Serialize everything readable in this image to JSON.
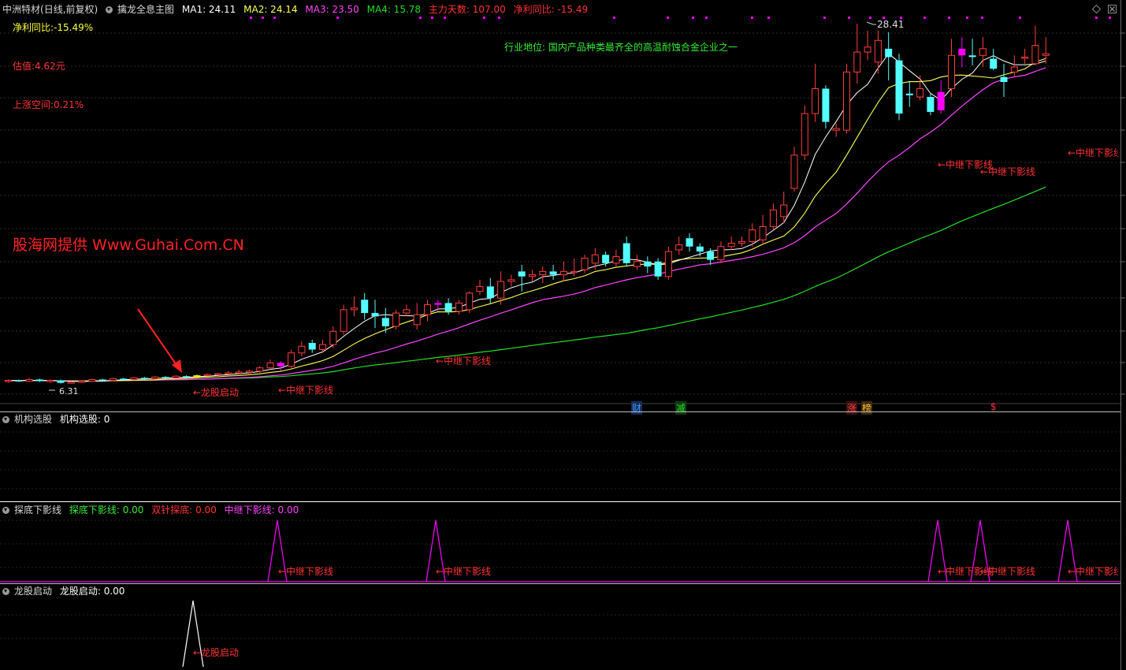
{
  "header": {
    "stock": "中洲特材",
    "mode": "(日线,前复权)",
    "indicator": "擒龙全息主图",
    "ma1": "MA1: 24.11",
    "ma2": "MA2: 24.14",
    "ma3": "MA3: 23.50",
    "ma4": "MA4: 15.78",
    "days": "主力天数: 107.00",
    "profit": "净利同比: -15.49"
  },
  "info": {
    "profit_yoy": "净利同比:-15.49%",
    "valuation": "估值:4.62元",
    "upside": "上涨空间:0.21%",
    "industry": "行业地位: 国内产品种类最齐全的高温耐蚀合金企业之一",
    "watermark": "股海网提供 Www.Guhai.Com.CN",
    "max_price": "28.41",
    "min_price": "6.31"
  },
  "event_icons": [
    "财",
    "减",
    "涨",
    "榜",
    "$"
  ],
  "panel2": {
    "name": "机构选股",
    "value": "机构选股: 0"
  },
  "panel3": {
    "name": "探底下影线",
    "v1": "探底下影线: 0.00",
    "v2": "双针探底: 0.00",
    "v3": "中继下影线: 0.00"
  },
  "panel4": {
    "name": "龙股启动",
    "value": "龙股启动: 0.00"
  },
  "annotations": {
    "relay": "←中继下影线",
    "dragon": "←龙股启动"
  },
  "colors": {
    "up": "#ff3c3c",
    "down": "#54ffff",
    "ma1": "#ffffff",
    "ma2": "#ffff55",
    "ma3": "#ff44ff",
    "ma4": "#22dd22",
    "signal": "#ff00ff"
  },
  "chart_data": {
    "type": "candlestick",
    "price_range": [
      6.31,
      28.41
    ],
    "candles": [
      {
        "o": 6.9,
        "c": 6.95,
        "h": 7.0,
        "l": 6.8
      },
      {
        "o": 6.95,
        "c": 6.9,
        "h": 7.0,
        "l": 6.85
      },
      {
        "o": 6.9,
        "c": 7.0,
        "h": 7.1,
        "l": 6.85
      },
      {
        "o": 7.0,
        "c": 6.9,
        "h": 7.05,
        "l": 6.85
      },
      {
        "o": 6.9,
        "c": 6.95,
        "h": 7.0,
        "l": 6.8
      },
      {
        "o": 6.95,
        "c": 6.8,
        "h": 7.0,
        "l": 6.75
      },
      {
        "o": 6.8,
        "c": 6.85,
        "h": 6.9,
        "l": 6.75
      },
      {
        "o": 6.85,
        "c": 6.9,
        "h": 6.95,
        "l": 6.8
      },
      {
        "o": 6.9,
        "c": 7.0,
        "h": 7.05,
        "l": 6.85
      },
      {
        "o": 7.0,
        "c": 6.95,
        "h": 7.05,
        "l": 6.9
      },
      {
        "o": 6.95,
        "c": 7.05,
        "h": 7.1,
        "l": 6.9
      },
      {
        "o": 7.05,
        "c": 7.0,
        "h": 7.1,
        "l": 6.95
      },
      {
        "o": 7.0,
        "c": 7.1,
        "h": 7.15,
        "l": 6.95
      },
      {
        "o": 7.1,
        "c": 7.05,
        "h": 7.15,
        "l": 7.0
      },
      {
        "o": 7.05,
        "c": 7.15,
        "h": 7.2,
        "l": 7.0
      },
      {
        "o": 7.15,
        "c": 7.1,
        "h": 7.2,
        "l": 7.05
      },
      {
        "o": 7.1,
        "c": 7.2,
        "h": 7.25,
        "l": 7.05
      },
      {
        "o": 7.2,
        "c": 7.15,
        "h": 7.25,
        "l": 7.1
      },
      {
        "o": 7.15,
        "c": 7.25,
        "h": 7.3,
        "l": 7.1
      },
      {
        "o": 7.25,
        "c": 7.3,
        "h": 7.35,
        "l": 7.2
      },
      {
        "o": 7.3,
        "c": 7.35,
        "h": 7.4,
        "l": 7.25
      },
      {
        "o": 7.35,
        "c": 7.4,
        "h": 7.5,
        "l": 7.3
      },
      {
        "o": 7.4,
        "c": 7.45,
        "h": 7.6,
        "l": 7.35
      },
      {
        "o": 7.45,
        "c": 7.5,
        "h": 7.6,
        "l": 7.4
      },
      {
        "o": 7.5,
        "c": 7.7,
        "h": 7.8,
        "l": 7.4
      },
      {
        "o": 7.7,
        "c": 8.0,
        "h": 8.2,
        "l": 7.6
      },
      {
        "o": 8.0,
        "c": 7.8,
        "h": 8.1,
        "l": 7.5
      },
      {
        "o": 7.8,
        "c": 8.6,
        "h": 8.8,
        "l": 7.7
      },
      {
        "o": 8.6,
        "c": 9.0,
        "h": 9.3,
        "l": 8.4
      },
      {
        "o": 9.2,
        "c": 8.8,
        "h": 9.4,
        "l": 8.6
      },
      {
        "o": 8.8,
        "c": 9.1,
        "h": 9.4,
        "l": 8.6
      },
      {
        "o": 9.1,
        "c": 9.9,
        "h": 10.2,
        "l": 8.9
      },
      {
        "o": 9.9,
        "c": 11.2,
        "h": 11.5,
        "l": 9.7
      },
      {
        "o": 11.2,
        "c": 11.3,
        "h": 12.0,
        "l": 10.8
      },
      {
        "o": 11.8,
        "c": 11.0,
        "h": 12.2,
        "l": 10.6
      },
      {
        "o": 11.0,
        "c": 10.8,
        "h": 11.8,
        "l": 10.1
      },
      {
        "o": 10.7,
        "c": 10.2,
        "h": 11.3,
        "l": 9.8
      },
      {
        "o": 10.2,
        "c": 11.0,
        "h": 11.2,
        "l": 10.0
      },
      {
        "o": 11.0,
        "c": 11.2,
        "h": 11.5,
        "l": 10.8
      },
      {
        "o": 10.3,
        "c": 10.9,
        "h": 11.6,
        "l": 10.0
      },
      {
        "o": 10.9,
        "c": 11.5,
        "h": 11.8,
        "l": 10.5
      },
      {
        "o": 11.5,
        "c": 11.6,
        "h": 11.8,
        "l": 11.1
      },
      {
        "o": 11.6,
        "c": 11.1,
        "h": 11.9,
        "l": 10.9
      },
      {
        "o": 11.1,
        "c": 11.6,
        "h": 11.8,
        "l": 10.9
      },
      {
        "o": 11.2,
        "c": 12.2,
        "h": 12.3,
        "l": 11.0
      },
      {
        "o": 12.3,
        "c": 12.6,
        "h": 13.0,
        "l": 12.1
      },
      {
        "o": 12.6,
        "c": 11.9,
        "h": 13.1,
        "l": 11.6
      },
      {
        "o": 11.9,
        "c": 12.9,
        "h": 13.5,
        "l": 11.5
      },
      {
        "o": 12.9,
        "c": 13.0,
        "h": 13.3,
        "l": 12.6
      },
      {
        "o": 13.5,
        "c": 13.2,
        "h": 13.9,
        "l": 12.3
      },
      {
        "o": 13.2,
        "c": 13.3,
        "h": 13.6,
        "l": 12.9
      },
      {
        "o": 13.3,
        "c": 13.5,
        "h": 13.8,
        "l": 12.8
      },
      {
        "o": 13.5,
        "c": 13.3,
        "h": 13.9,
        "l": 13.0
      },
      {
        "o": 13.3,
        "c": 13.5,
        "h": 14.1,
        "l": 12.9
      },
      {
        "o": 13.5,
        "c": 13.5,
        "h": 14.3,
        "l": 13.2
      },
      {
        "o": 13.6,
        "c": 14.3,
        "h": 14.5,
        "l": 13.4
      },
      {
        "o": 14.0,
        "c": 14.5,
        "h": 14.9,
        "l": 13.6
      },
      {
        "o": 14.5,
        "c": 14.0,
        "h": 14.7,
        "l": 13.8
      },
      {
        "o": 14.0,
        "c": 14.4,
        "h": 14.8,
        "l": 13.8
      },
      {
        "o": 15.2,
        "c": 14.0,
        "h": 15.6,
        "l": 13.8
      },
      {
        "o": 13.8,
        "c": 14.1,
        "h": 14.5,
        "l": 13.6
      },
      {
        "o": 14.1,
        "c": 13.8,
        "h": 14.4,
        "l": 13.4
      },
      {
        "o": 14.1,
        "c": 13.2,
        "h": 14.3,
        "l": 13.0
      },
      {
        "o": 13.2,
        "c": 14.7,
        "h": 15.0,
        "l": 13.0
      },
      {
        "o": 14.8,
        "c": 15.1,
        "h": 15.6,
        "l": 14.5
      },
      {
        "o": 15.5,
        "c": 15.0,
        "h": 15.8,
        "l": 14.7
      },
      {
        "o": 15.0,
        "c": 14.7,
        "h": 15.2,
        "l": 14.4
      },
      {
        "o": 14.7,
        "c": 14.2,
        "h": 14.9,
        "l": 13.9
      },
      {
        "o": 14.2,
        "c": 15.0,
        "h": 15.3,
        "l": 14.0
      },
      {
        "o": 15.0,
        "c": 15.2,
        "h": 15.6,
        "l": 14.8
      },
      {
        "o": 15.2,
        "c": 15.3,
        "h": 15.6,
        "l": 15.0
      },
      {
        "o": 15.3,
        "c": 16.0,
        "h": 16.4,
        "l": 15.0
      },
      {
        "o": 15.4,
        "c": 16.2,
        "h": 16.9,
        "l": 15.1
      },
      {
        "o": 16.2,
        "c": 17.2,
        "h": 17.6,
        "l": 16.0
      },
      {
        "o": 16.8,
        "c": 17.5,
        "h": 18.3,
        "l": 16.4
      },
      {
        "o": 18.5,
        "c": 20.5,
        "h": 21.0,
        "l": 18.3
      },
      {
        "o": 20.5,
        "c": 23.0,
        "h": 23.5,
        "l": 20.2
      },
      {
        "o": 23.0,
        "c": 24.5,
        "h": 26.0,
        "l": 22.5
      },
      {
        "o": 24.5,
        "c": 22.5,
        "h": 24.7,
        "l": 22.1
      },
      {
        "o": 22.0,
        "c": 22.1,
        "h": 22.4,
        "l": 21.6
      },
      {
        "o": 22.0,
        "c": 25.5,
        "h": 26.0,
        "l": 21.8
      },
      {
        "o": 25.5,
        "c": 26.7,
        "h": 28.41,
        "l": 24.8
      },
      {
        "o": 26.7,
        "c": 27.0,
        "h": 28.0,
        "l": 26.2
      },
      {
        "o": 26.1,
        "c": 27.4,
        "h": 28.0,
        "l": 25.4
      },
      {
        "o": 26.9,
        "c": 26.4,
        "h": 27.9,
        "l": 25.0
      },
      {
        "o": 26.2,
        "c": 23.0,
        "h": 26.6,
        "l": 22.6
      },
      {
        "o": 24.2,
        "c": 24.1,
        "h": 24.9,
        "l": 23.4
      },
      {
        "o": 24.0,
        "c": 24.5,
        "h": 25.3,
        "l": 23.8
      },
      {
        "o": 24.0,
        "c": 23.1,
        "h": 24.2,
        "l": 22.9
      },
      {
        "o": 23.2,
        "c": 24.3,
        "h": 25.0,
        "l": 23.0
      },
      {
        "o": 24.5,
        "c": 26.5,
        "h": 27.5,
        "l": 24.0
      },
      {
        "o": 26.5,
        "c": 26.9,
        "h": 27.6,
        "l": 25.8
      },
      {
        "o": 26.5,
        "c": 26.4,
        "h": 27.5,
        "l": 25.9
      },
      {
        "o": 26.5,
        "c": 26.9,
        "h": 27.6,
        "l": 25.8
      },
      {
        "o": 26.3,
        "c": 25.7,
        "h": 26.9,
        "l": 25.6
      },
      {
        "o": 25.2,
        "c": 24.9,
        "h": 26.0,
        "l": 24.0
      },
      {
        "o": 25.5,
        "c": 25.8,
        "h": 26.5,
        "l": 25.2
      },
      {
        "o": 26.4,
        "c": 26.4,
        "h": 26.9,
        "l": 26.0
      },
      {
        "o": 26.0,
        "c": 27.1,
        "h": 28.3,
        "l": 25.9
      },
      {
        "o": 26.5,
        "c": 26.6,
        "h": 27.6,
        "l": 26.0
      }
    ],
    "ma_end_values": {
      "MA1": 24.11,
      "MA2": 24.14,
      "MA3": 23.5,
      "MA4": 15.78
    }
  }
}
